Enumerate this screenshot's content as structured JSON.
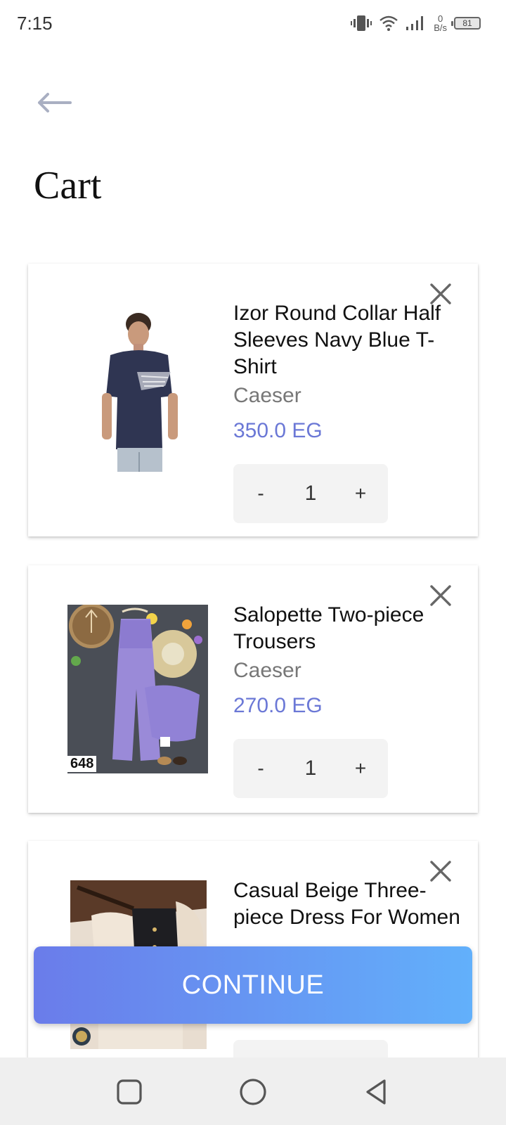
{
  "status": {
    "time": "7:15",
    "net_speed_value": "0",
    "net_speed_unit": "B/s",
    "battery": "81"
  },
  "header": {
    "title": "Cart"
  },
  "cart": {
    "items": [
      {
        "name": "Izor Round Collar Half Sleeves Navy Blue T-Shirt",
        "brand": "Caeser",
        "price": "350.0 EG",
        "quantity": "1",
        "minus": "-",
        "plus": "+"
      },
      {
        "name": "Salopette Two-piece Trousers",
        "brand": "Caeser",
        "price": "270.0 EG",
        "quantity": "1",
        "minus": "-",
        "plus": "+",
        "image_tag": "648"
      },
      {
        "name": "Casual Beige Three-piece Dress For Women"
      }
    ]
  },
  "continue_label": "CONTINUE",
  "colors": {
    "price": "#6b78d6",
    "button_gradient_start": "#6a7cea",
    "button_gradient_end": "#62b0fb"
  }
}
